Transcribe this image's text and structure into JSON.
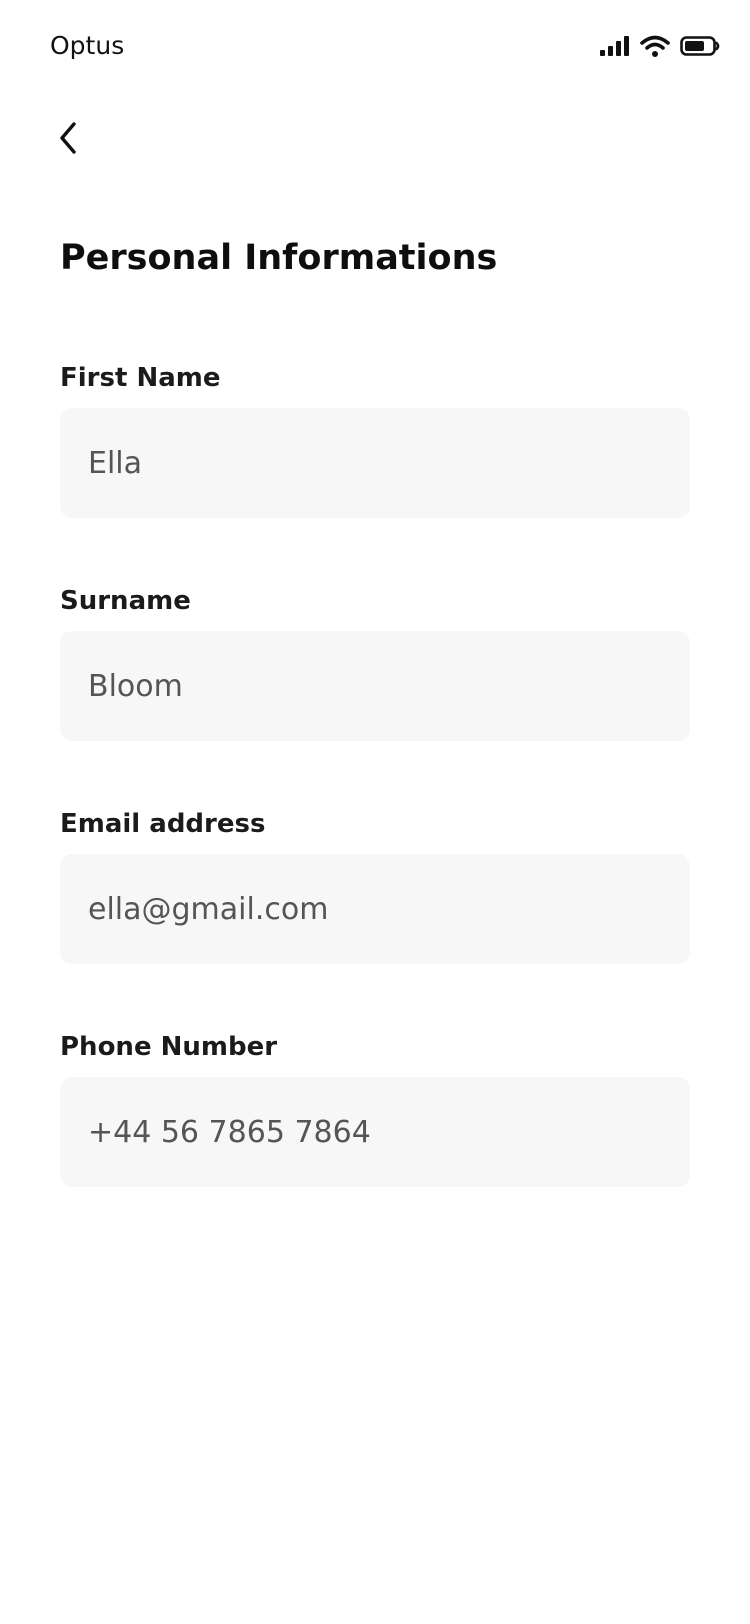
{
  "status_bar": {
    "carrier": "Optus",
    "icons": [
      "signal-icon",
      "wifi-icon",
      "battery-icon"
    ]
  },
  "header": {
    "back_icon": "chevron-left-icon"
  },
  "page": {
    "title": "Personal Informations"
  },
  "form": {
    "fields": [
      {
        "label": "First Name",
        "value": "Ella"
      },
      {
        "label": "Surname",
        "value": "Bloom"
      },
      {
        "label": "Email address",
        "value": "ella@gmail.com"
      },
      {
        "label": "Phone Number",
        "value": "+44 56 7865 7864"
      }
    ]
  },
  "colors": {
    "background": "#ffffff",
    "input_background": "#f7f7f7",
    "text_primary": "#0e0e0e",
    "input_text": "#555555"
  }
}
